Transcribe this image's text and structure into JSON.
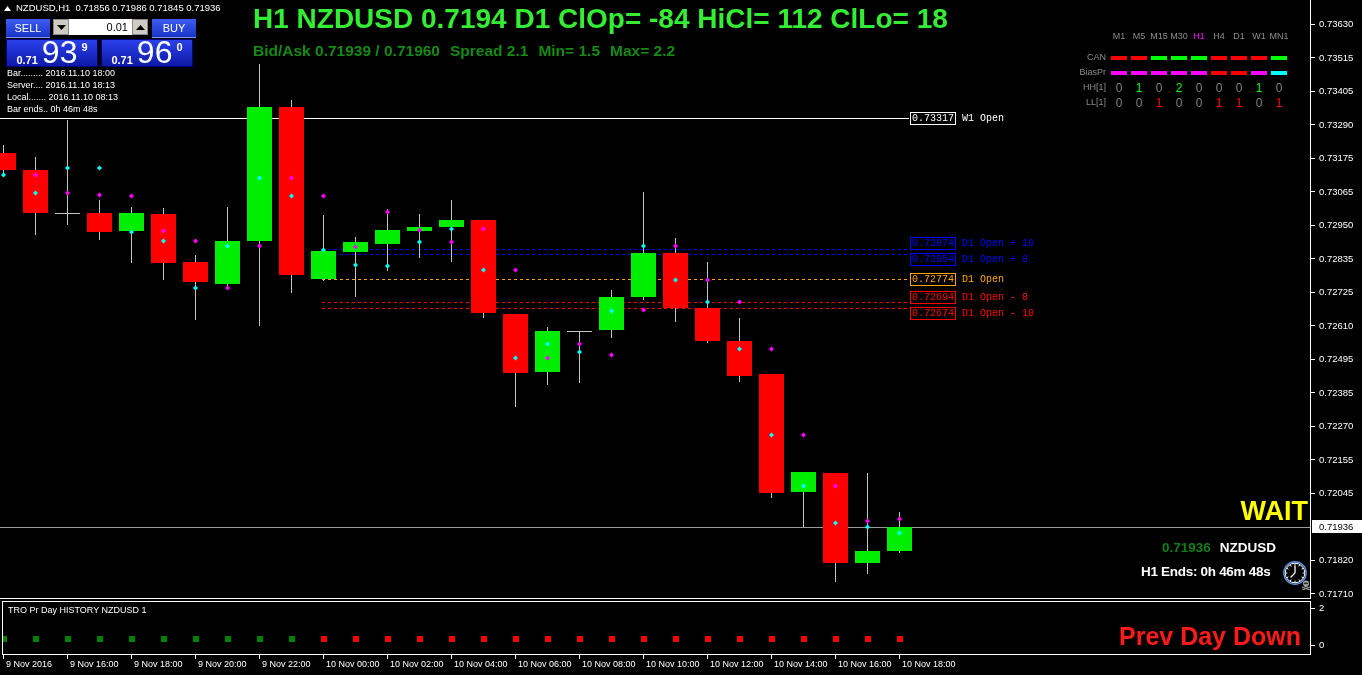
{
  "window": {
    "symbol": "NZDUSD,H1",
    "quotes": "0.71856 0.71986 0.71845 0.71936"
  },
  "trade_panel": {
    "sell_label": "SELL",
    "buy_label": "BUY",
    "lot": "0.01",
    "sell_quote": {
      "prefix": "0.71",
      "pips": "93",
      "fraction": "9"
    },
    "buy_quote": {
      "prefix": "0.71",
      "pips": "96",
      "fraction": "0"
    }
  },
  "time_info": [
    "Bar......... 2016.11.10 18:00",
    "Server.... 2016.11.10 18:13",
    "Local....... 2016.11.10 08:13",
    "Bar ends.. 0h 46m 48s"
  ],
  "headline": "H1 NZDUSD 0.7194 D1 ClOp= -84 HiCl= 112 ClLo= 18",
  "spread_info": [
    "Bid/Ask 0.71939 / 0.71960",
    "Spread 2.1",
    "Min= 1.5",
    "Max= 2.2"
  ],
  "timeframe_table": {
    "columns": [
      {
        "label": "M1",
        "selected": false
      },
      {
        "label": "M5",
        "selected": false
      },
      {
        "label": "M15",
        "selected": false
      },
      {
        "label": "M30",
        "selected": false
      },
      {
        "label": "H1",
        "selected": true
      },
      {
        "label": "H4",
        "selected": false
      },
      {
        "label": "D1",
        "selected": false
      },
      {
        "label": "W1",
        "selected": false
      },
      {
        "label": "MN1",
        "selected": false
      }
    ],
    "rows": [
      {
        "label": "CAN",
        "kind": "bar",
        "cells": [
          {
            "color": "#ff0000"
          },
          {
            "color": "#ff0000"
          },
          {
            "color": "#00ff00"
          },
          {
            "color": "#00ff00"
          },
          {
            "color": "#00ff00"
          },
          {
            "color": "#ff0000"
          },
          {
            "color": "#ff0000"
          },
          {
            "color": "#ff0000"
          },
          {
            "color": "#00ff00"
          }
        ]
      },
      {
        "label": "BiasPr",
        "kind": "bar",
        "cells": [
          {
            "color": "#ff00ff"
          },
          {
            "color": "#ff00ff"
          },
          {
            "color": "#ff00ff"
          },
          {
            "color": "#ff00ff"
          },
          {
            "color": "#ff00ff"
          },
          {
            "color": "#ff0000"
          },
          {
            "color": "#ff0000"
          },
          {
            "color": "#ff00ff"
          },
          {
            "color": "#00ffff"
          }
        ]
      },
      {
        "label": "HH[1]",
        "kind": "count",
        "cells": [
          {
            "text": "0",
            "color": "#808080"
          },
          {
            "text": "1",
            "color": "#00ff00"
          },
          {
            "text": "0",
            "color": "#808080"
          },
          {
            "text": "2",
            "color": "#00ff00"
          },
          {
            "text": "0",
            "color": "#808080"
          },
          {
            "text": "0",
            "color": "#808080"
          },
          {
            "text": "0",
            "color": "#808080"
          },
          {
            "text": "1",
            "color": "#00ff00"
          },
          {
            "text": "0",
            "color": "#808080"
          }
        ]
      },
      {
        "label": "LL[1]",
        "kind": "count",
        "cells": [
          {
            "text": "0",
            "color": "#808080"
          },
          {
            "text": "0",
            "color": "#808080"
          },
          {
            "text": "1",
            "color": "#ff0000"
          },
          {
            "text": "0",
            "color": "#808080"
          },
          {
            "text": "0",
            "color": "#808080"
          },
          {
            "text": "1",
            "color": "#ff0000"
          },
          {
            "text": "1",
            "color": "#ff0000"
          },
          {
            "text": "0",
            "color": "#808080"
          },
          {
            "text": "1",
            "color": "#ff0000"
          }
        ]
      }
    ]
  },
  "levels": [
    {
      "kind": "weekly",
      "price": "0.73317",
      "caption": "W1 Open",
      "color": "#ffffff"
    },
    {
      "kind": "daily",
      "price": "0.72874",
      "caption": "D1 Open + 10",
      "color": "#0000ff"
    },
    {
      "kind": "daily",
      "price": "0.72854",
      "caption": "D1 Open + 8",
      "color": "#0000ff"
    },
    {
      "kind": "daily",
      "price": "0.72774",
      "caption": "D1 Open",
      "color": "#ffa500"
    },
    {
      "kind": "daily",
      "price": "0.72694",
      "caption": "D1 Open - 8",
      "color": "#ff0000"
    },
    {
      "kind": "daily",
      "price": "0.72674",
      "caption": "D1 Open - 10",
      "color": "#ff0000"
    }
  ],
  "signal": {
    "action": "WAIT",
    "price": "0.71936",
    "symbol": "NZDUSD",
    "countdown": "H1 Ends: 0h 46m 48s"
  },
  "price_axis": {
    "ticks": [
      "0.73630",
      "0.73515",
      "0.73405",
      "0.73290",
      "0.73175",
      "0.73065",
      "0.72950",
      "0.72835",
      "0.72725",
      "0.72610",
      "0.72495",
      "0.72385",
      "0.72270",
      "0.72155",
      "0.72045",
      "0.71820",
      "0.71710"
    ],
    "current": "0.71936"
  },
  "indicator": {
    "title": "TRO Pr Day HISTORY NZDUSD 1",
    "status": "Prev Day Down",
    "scale": [
      "2",
      "0"
    ],
    "history": [
      {
        "color": "#008000"
      },
      {
        "color": "#008000"
      },
      {
        "color": "#008000"
      },
      {
        "color": "#008000"
      },
      {
        "color": "#008000"
      },
      {
        "color": "#008000"
      },
      {
        "color": "#008000"
      },
      {
        "color": "#008000"
      },
      {
        "color": "#008000"
      },
      {
        "color": "#008000"
      },
      {
        "color": "#ff0000"
      },
      {
        "color": "#ff0000"
      },
      {
        "color": "#ff0000"
      },
      {
        "color": "#ff0000"
      },
      {
        "color": "#ff0000"
      },
      {
        "color": "#ff0000"
      },
      {
        "color": "#ff0000"
      },
      {
        "color": "#ff0000"
      },
      {
        "color": "#ff0000"
      },
      {
        "color": "#ff0000"
      },
      {
        "color": "#ff0000"
      },
      {
        "color": "#ff0000"
      },
      {
        "color": "#ff0000"
      },
      {
        "color": "#ff0000"
      },
      {
        "color": "#ff0000"
      },
      {
        "color": "#ff0000"
      },
      {
        "color": "#ff0000"
      },
      {
        "color": "#ff0000"
      },
      {
        "color": "#ff0000"
      }
    ]
  },
  "time_axis": [
    "9 Nov 2016",
    "9 Nov 16:00",
    "9 Nov 18:00",
    "9 Nov 20:00",
    "9 Nov 22:00",
    "10 Nov 00:00",
    "10 Nov 02:00",
    "10 Nov 04:00",
    "10 Nov 06:00",
    "10 Nov 08:00",
    "10 Nov 10:00",
    "10 Nov 12:00",
    "10 Nov 14:00",
    "10 Nov 16:00",
    "10 Nov 18:00"
  ]
}
